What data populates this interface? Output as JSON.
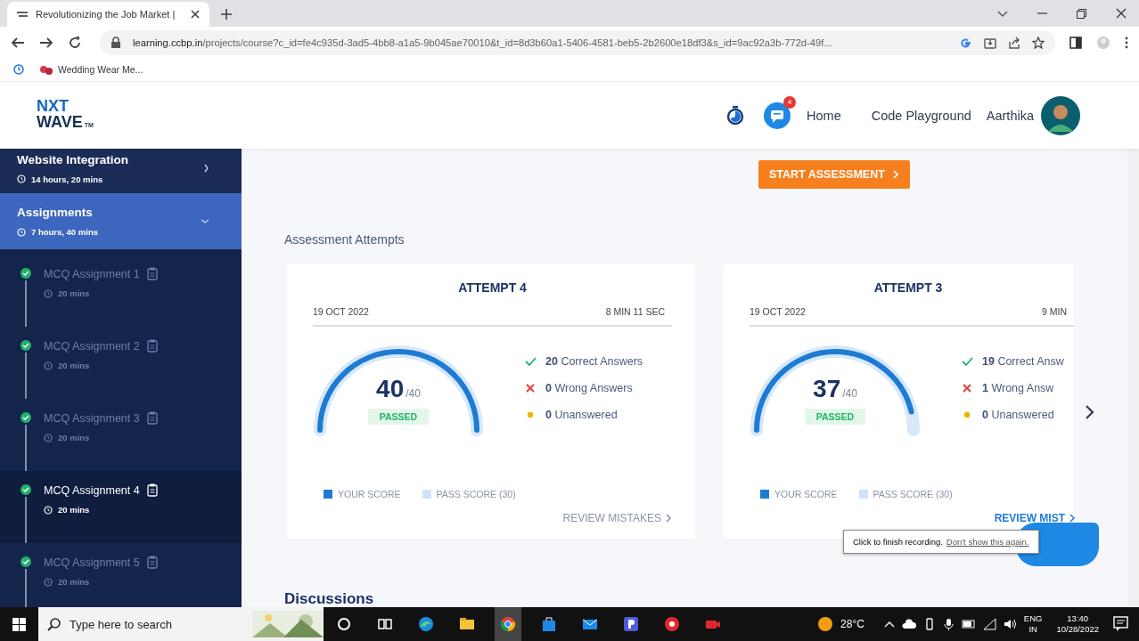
{
  "browser": {
    "tab_title": "Revolutionizing the Job Market |",
    "url_host": "learning.ccbp.in",
    "url_path": "/projects/course?c_id=fe4c935d-3ad5-4bb8-a1a5-9b045ae70010&t_id=8d3b60a1-5406-4581-beb5-2b2600e18df3&s_id=9ac92a3b-772d-49f...",
    "bookmarks": [
      "Wedding Wear Me..."
    ]
  },
  "header": {
    "logo_line1": "NXT",
    "logo_line2": "WAVE",
    "logo_mark": "TM",
    "notification_count": "4",
    "nav": [
      "Home",
      "Code Playground"
    ],
    "user_name": "Aarthika"
  },
  "sidebar": {
    "sections": [
      {
        "title": "Website Integration",
        "duration": "14 hours, 20 mins",
        "expanded": false,
        "selected": false
      },
      {
        "title": "Assignments",
        "duration": "7 hours, 40 mins",
        "expanded": true,
        "selected": true,
        "children": [
          {
            "title": "MCQ Assignment 1",
            "duration": "20 mins",
            "completed": true,
            "selected": false
          },
          {
            "title": "MCQ Assignment 2",
            "duration": "20 mins",
            "completed": true,
            "selected": false
          },
          {
            "title": "MCQ Assignment 3",
            "duration": "20 mins",
            "completed": true,
            "selected": false
          },
          {
            "title": "MCQ Assignment 4",
            "duration": "20 mins",
            "completed": true,
            "selected": true
          },
          {
            "title": "MCQ Assignment 5",
            "duration": "20 mins",
            "completed": true,
            "selected": false
          }
        ]
      }
    ]
  },
  "main": {
    "start_button": "START ASSESSMENT",
    "attempts_heading": "Assessment Attempts",
    "attempts": [
      {
        "title": "ATTEMPT 4",
        "date": "19 OCT 2022",
        "duration": "8 MIN 11 SEC",
        "score": "40",
        "total": "/40",
        "result": "PASSED",
        "stats": [
          {
            "kind": "correct",
            "count": "20",
            "label": "Correct Answers"
          },
          {
            "kind": "wrong",
            "count": "0",
            "label": "Wrong Answers"
          },
          {
            "kind": "unanswered",
            "count": "0",
            "label": "Unanswered"
          }
        ],
        "legend": [
          "YOUR SCORE",
          "PASS SCORE (30)"
        ],
        "review": "REVIEW MISTAKES",
        "review_highlighted": false
      },
      {
        "title": "ATTEMPT 3",
        "date": "19 OCT 2022",
        "duration": "9 MIN",
        "score": "37",
        "total": "/40",
        "result": "PASSED",
        "stats": [
          {
            "kind": "correct",
            "count": "19",
            "label": "Correct Answ"
          },
          {
            "kind": "wrong",
            "count": "1",
            "label": "Wrong Answ"
          },
          {
            "kind": "unanswered",
            "count": "0",
            "label": "Unanswered"
          }
        ],
        "legend": [
          "YOUR SCORE",
          "PASS SCORE (30)"
        ],
        "review": "REVIEW MIST",
        "review_highlighted": true
      }
    ],
    "discussions_heading": "Discussions"
  },
  "recorder_tooltip": {
    "text": "Click to finish recording.",
    "link": "Don't show this again."
  },
  "taskbar": {
    "search_placeholder": "Type here to search",
    "temperature": "28°C",
    "language": [
      "ENG",
      "IN"
    ],
    "time": "13:40",
    "date": "10/28/2022"
  }
}
